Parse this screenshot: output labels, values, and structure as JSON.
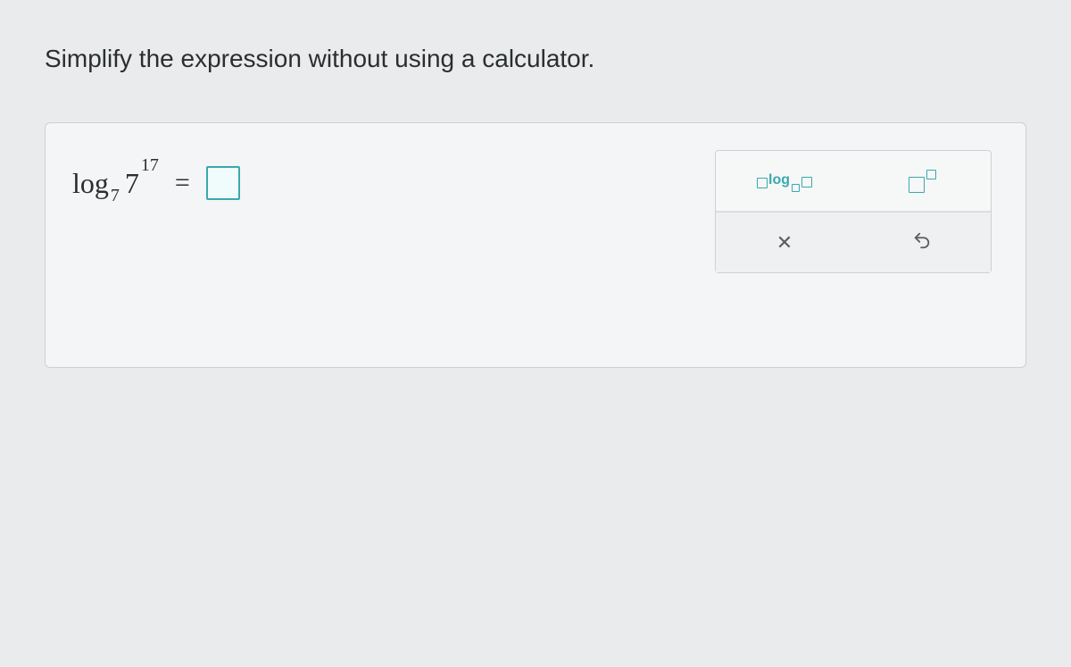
{
  "prompt": "Simplify the expression without using a calculator.",
  "expression": {
    "log_word": "log",
    "base": "7",
    "arg_base": "7",
    "arg_exp": "17",
    "equals": "="
  },
  "palette": {
    "log_label": "log"
  }
}
